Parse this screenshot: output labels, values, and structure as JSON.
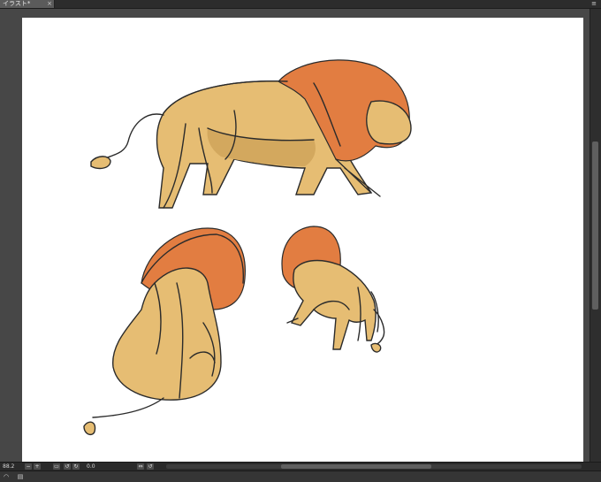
{
  "tabbar": {
    "tab_label": "イラスト*",
    "tab_close_glyph": "×",
    "menu_glyph": "≡"
  },
  "artwork": {
    "accent_colors": {
      "lion_body": "#e6bd73",
      "lion_mane": "#e27d41",
      "body_shadow": "#d3a85e",
      "outline": "#2b2b2b"
    }
  },
  "statusbar": {
    "zoom_value": "88.2",
    "zoom_out_glyph": "−",
    "zoom_in_glyph": "+",
    "fit_glyph": "▭",
    "angle_value": "0.0",
    "rotate_left_glyph": "↺",
    "rotate_right_glyph": "↻",
    "flip_glyph": "⇔",
    "icon_names": [
      "zoom-out-icon",
      "zoom-in-icon",
      "fit-screen-icon",
      "rotate-left-icon",
      "rotate-right-icon",
      "flip-icon"
    ]
  },
  "bottombar": {
    "icon_names": [
      "navigator-icon",
      "layer-panel-icon"
    ],
    "navigator_glyph": "◠",
    "layer_glyph": "▤"
  }
}
